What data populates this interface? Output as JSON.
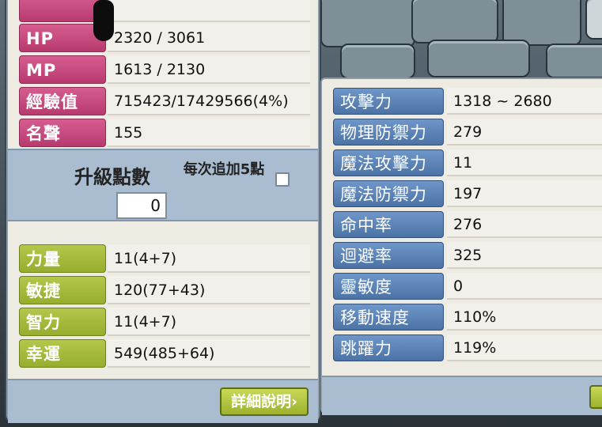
{
  "left": {
    "partial_label": "",
    "rows": [
      {
        "label": "HP",
        "value": "2320 / 3061"
      },
      {
        "label": "MP",
        "value": "1613 / 2130"
      },
      {
        "label": "經驗值",
        "value": "715423/17429566(4%)"
      },
      {
        "label": "名聲",
        "value": "155"
      }
    ],
    "ap_title": "升級點數",
    "ap_value": "0",
    "ap_auto_label": "每次追加5點",
    "stats": [
      {
        "label": "力量",
        "value": "11(4+7)"
      },
      {
        "label": "敏捷",
        "value": "120(77+43)"
      },
      {
        "label": "智力",
        "value": "11(4+7)"
      },
      {
        "label": "幸運",
        "value": "549(485+64)"
      }
    ],
    "detail_button": "詳細說明",
    "detail_arrow": "›"
  },
  "right": {
    "rows": [
      {
        "label": "攻擊力",
        "value": "1318 ~ 2680"
      },
      {
        "label": "物理防禦力",
        "value": "279"
      },
      {
        "label": "魔法攻擊力",
        "value": "11"
      },
      {
        "label": "魔法防禦力",
        "value": "197"
      },
      {
        "label": "命中率",
        "value": "276"
      },
      {
        "label": "迴避率",
        "value": "325"
      },
      {
        "label": "靈敏度",
        "value": "0"
      },
      {
        "label": "移動速度",
        "value": "110%"
      },
      {
        "label": "跳躍力",
        "value": "119%"
      }
    ]
  },
  "colors": {
    "pink_label": "#c44a7e",
    "green_label": "#a6ba3a",
    "blue_label": "#5b82b5",
    "panel_blue": "#a9bcd0",
    "window_bg": "#eeebe2"
  }
}
